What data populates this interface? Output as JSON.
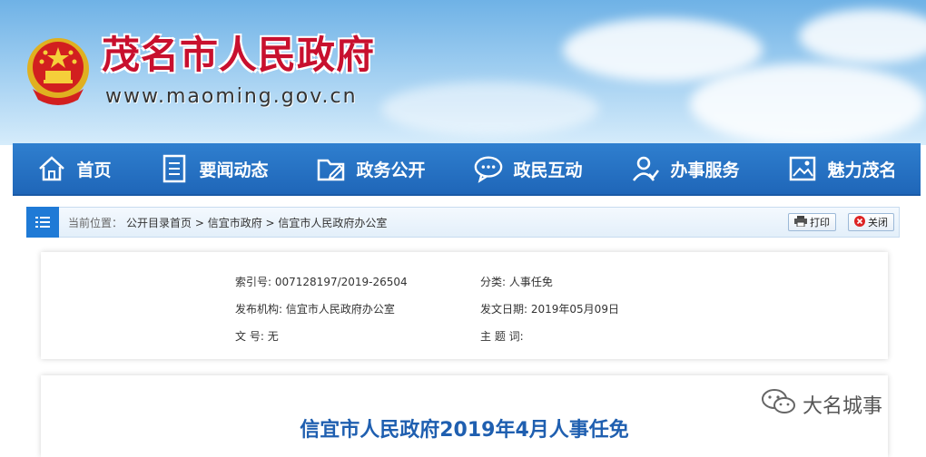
{
  "header": {
    "site_title": "茂名市人民政府",
    "site_url": "www.maoming.gov.cn"
  },
  "nav": {
    "items": [
      {
        "label": "首页",
        "icon": "home-icon"
      },
      {
        "label": "要闻动态",
        "icon": "document-icon"
      },
      {
        "label": "政务公开",
        "icon": "folder-icon"
      },
      {
        "label": "政民互动",
        "icon": "chat-icon"
      },
      {
        "label": "办事服务",
        "icon": "person-service-icon"
      },
      {
        "label": "魅力茂名",
        "icon": "picture-icon"
      }
    ]
  },
  "breadcrumb": {
    "label": "当前位置：",
    "path": "公开目录首页 > 信宜市政府 > 信宜市人民政府办公室",
    "print_label": "打印",
    "close_label": "关闭"
  },
  "metadata": {
    "index_label": "索引号:",
    "index_value": "007128197/2019-26504",
    "category_label": "分类:",
    "category_value": "人事任免",
    "publisher_label": "发布机构:",
    "publisher_value": "信宜市人民政府办公室",
    "date_label": "发文日期:",
    "date_value": "2019年05月09日",
    "docno_label": "文 号:",
    "docno_value": "无",
    "keywords_label": "主 题 词:",
    "keywords_value": ""
  },
  "document": {
    "title": "信宜市人民政府2019年4月人事任免"
  },
  "watermark": {
    "text": "大名城事"
  },
  "colors": {
    "title_red": "#c8102e",
    "nav_blue": "#1f66b8",
    "doc_title_blue": "#1f5fb0"
  }
}
